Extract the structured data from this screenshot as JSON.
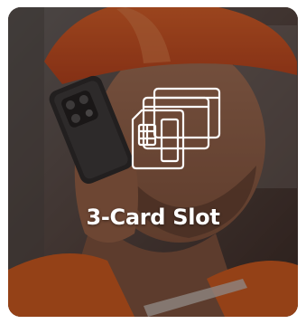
{
  "feature": {
    "label": "3-Card Slot",
    "icon": "sim-cards-icon"
  },
  "colors": {
    "helmet": "#e2541c",
    "vest": "#e2621e",
    "overlay": "#140e0c",
    "text": "#ffffff"
  }
}
